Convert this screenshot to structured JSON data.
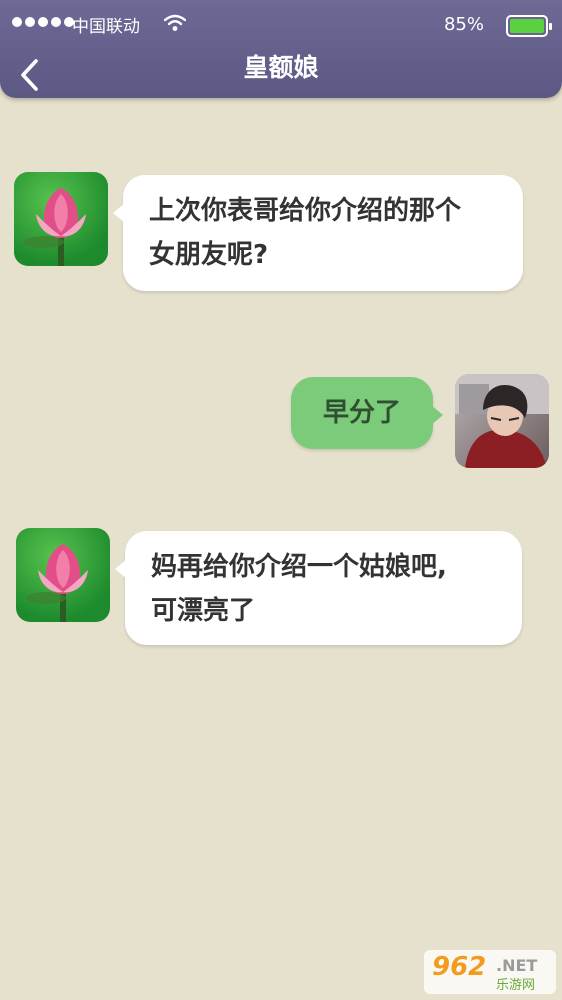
{
  "status_bar": {
    "carrier": "中国联动",
    "battery_pct": "85%",
    "battery_level": 1.0,
    "signal_dots": 5
  },
  "header": {
    "title": "皇额娘",
    "back_icon": "chevron-left-icon"
  },
  "messages": [
    {
      "side": "left",
      "avatar": "lotus-avatar",
      "lines": [
        "上次你表哥给你介绍的那个",
        "女朋友呢?"
      ]
    },
    {
      "side": "right",
      "avatar": "boy-avatar",
      "lines": [
        "早分了"
      ]
    },
    {
      "side": "left",
      "avatar": "lotus-avatar",
      "lines": [
        "妈再给你介绍一个姑娘吧,",
        "可漂亮了"
      ]
    }
  ],
  "watermark": {
    "number": "962",
    "suffix": ".NET",
    "cn": "乐游网"
  },
  "colors": {
    "background": "#e6e1cc",
    "header": "#625e8a",
    "left_bubble": "#ffffff",
    "right_bubble": "#7ccb7a",
    "battery": "#5ad13e"
  }
}
